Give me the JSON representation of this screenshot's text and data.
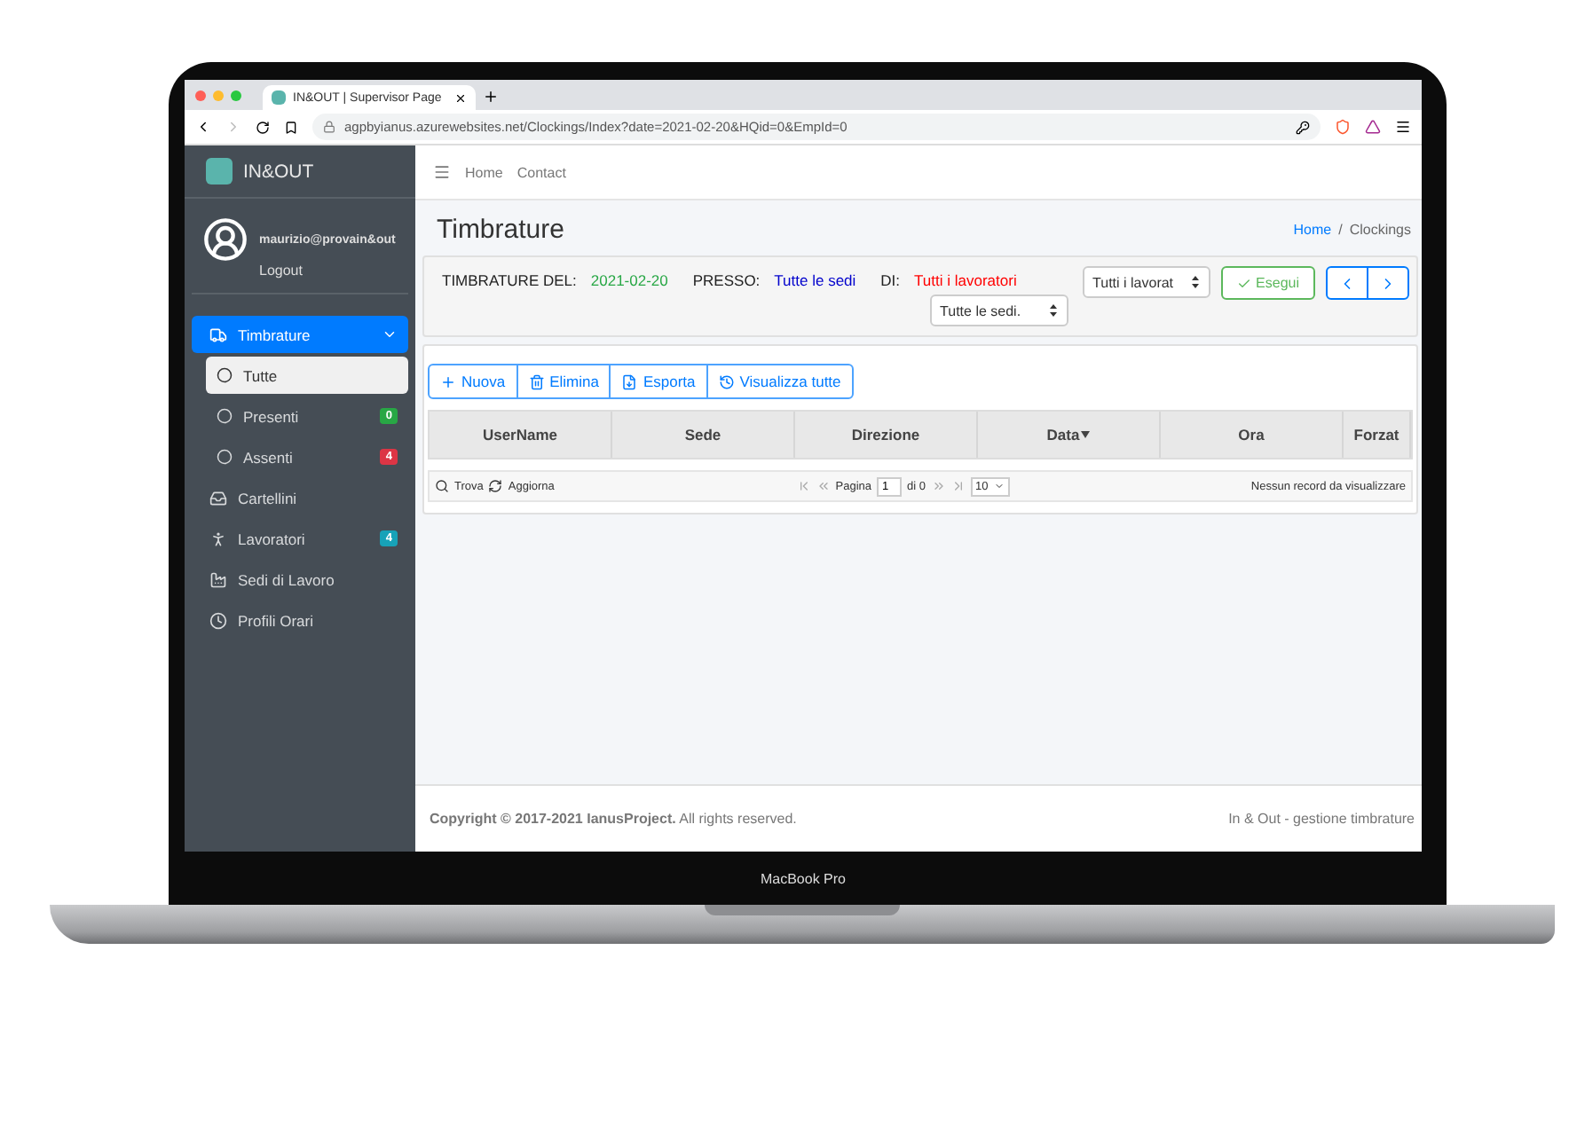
{
  "browser": {
    "tab_title": "IN&OUT | Supervisor Page",
    "url": "agpbyianus.azurewebsites.net/Clockings/Index?date=2021-02-20&HQid=0&EmpId=0"
  },
  "sidebar": {
    "brand": "IN&OUT",
    "user": {
      "email": "maurizio@provain&out",
      "link": "Logout"
    },
    "nav": [
      {
        "label": "Timbrature",
        "selected": true,
        "expanded": true,
        "children": [
          {
            "label": "Tutte",
            "selected": true
          },
          {
            "label": "Presenti",
            "selected": false,
            "badge": "0",
            "color": "#28a745"
          },
          {
            "label": "Assenti",
            "selected": false,
            "badge": "4",
            "color": "#dc3545"
          }
        ]
      },
      {
        "label": "Cartellini",
        "selected": false
      },
      {
        "label": "Lavoratori",
        "selected": false,
        "badge": "4",
        "color": "#17a2b8"
      },
      {
        "label": "Sedi di Lavoro",
        "selected": false
      },
      {
        "label": "Profili Orari",
        "selected": false
      }
    ]
  },
  "topnav": [
    "Home",
    "Contact"
  ],
  "page_title": "Timbrature",
  "breadcrumb": {
    "items": [
      "Home",
      "Clockings"
    ],
    "separator": "/"
  },
  "filter": {
    "summary": [
      {
        "label": "TIMBRATURE DEL:",
        "value": "2021-02-20",
        "color": "#28a745"
      },
      {
        "label": "PRESSO:",
        "value": "Tutte le sedi",
        "color": "#0000cc"
      },
      {
        "label": "DI:",
        "value": "Tutti i lavoratori",
        "color": "#ff0000"
      }
    ],
    "site_select": "Tutte le sedi.",
    "worker_select": "Tutti i lavorat",
    "run_button": "Esegui"
  },
  "toolbar": [
    "Nuova",
    "Elimina",
    "Esporta",
    "Visualizza tutte"
  ],
  "table": {
    "columns": [
      {
        "label": "UserName",
        "sorted": false
      },
      {
        "label": "Sede",
        "sorted": false
      },
      {
        "label": "Direzione",
        "sorted": false
      },
      {
        "label": "Data",
        "sorted": true
      },
      {
        "label": "Ora",
        "sorted": false
      },
      {
        "label": "Forzat",
        "sorted": false
      }
    ]
  },
  "pager": {
    "find": "Trova",
    "refresh": "Aggiorna",
    "page_label": "Pagina",
    "page": "1",
    "of": "di 0",
    "page_size": "10",
    "info": "Nessun record da visualizzare"
  },
  "footer": {
    "left": "**Copyright © 2017-2021 IanusProject.** All rights reserved.",
    "right": "In & Out - gestione timbrature"
  },
  "laptop_label": "MacBook Pro"
}
